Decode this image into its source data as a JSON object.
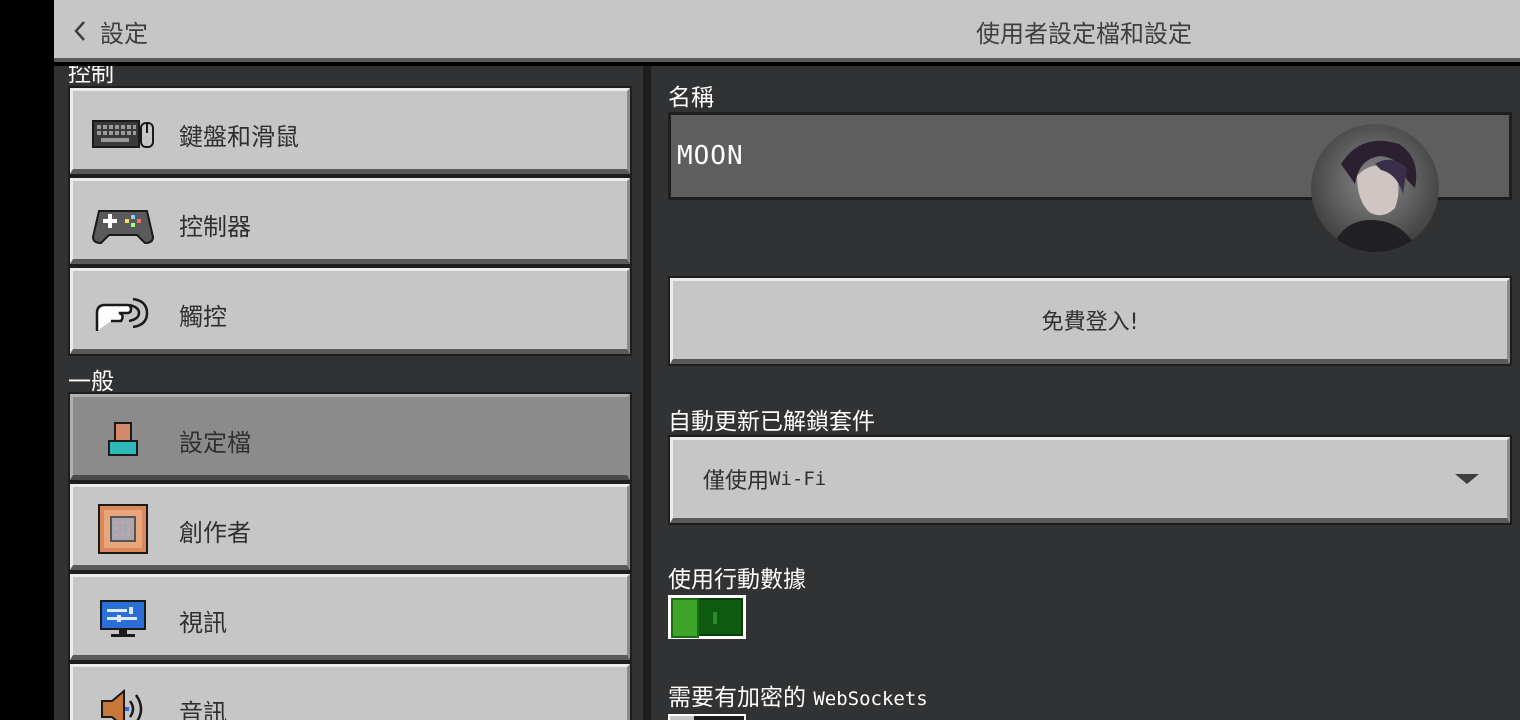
{
  "header": {
    "back_label": "設定",
    "title": "使用者設定檔和設定"
  },
  "sidebar": {
    "section_controls": "控制",
    "section_general": "一般",
    "items": [
      {
        "label": "鍵盤和滑鼠",
        "icon": "keyboard-mouse-icon"
      },
      {
        "label": "控制器",
        "icon": "gamepad-icon"
      },
      {
        "label": "觸控",
        "icon": "touch-hand-icon"
      },
      {
        "label": "設定檔",
        "icon": "profile-icon",
        "selected": true
      },
      {
        "label": "創作者",
        "icon": "command-block-icon"
      },
      {
        "label": "視訊",
        "icon": "monitor-icon"
      },
      {
        "label": "音訊",
        "icon": "speaker-icon"
      }
    ]
  },
  "main": {
    "name_label": "名稱",
    "name_value": "MOON",
    "signin_button": "免費登入!",
    "auto_update_label": "自動更新已解鎖套件",
    "auto_update_value_prefix": "僅使用 ",
    "auto_update_value_suffix": "Wi-Fi",
    "cellular_label": "使用行動數據",
    "cellular_on": true,
    "websockets_label_prefix": "需要有加密的 ",
    "websockets_label_suffix": "WebSockets"
  },
  "colors": {
    "panel": "#313233",
    "button": "#c6c6c6",
    "toggle_on": "#3ea52a"
  }
}
